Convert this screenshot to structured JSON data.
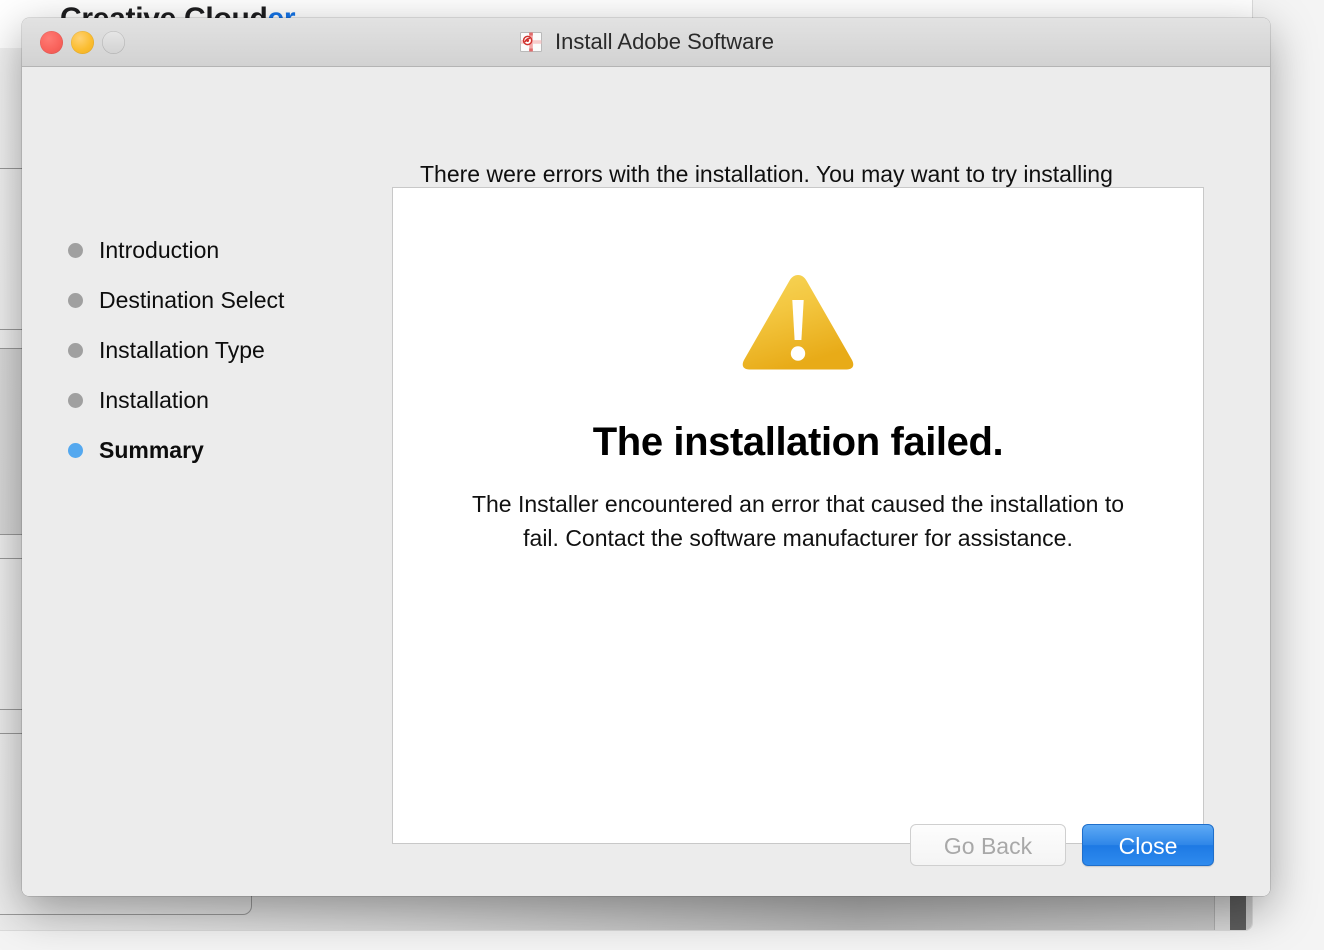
{
  "background_window": {
    "title_prefix": "Creative Cloud",
    "title_suffix": "er",
    "scrollbar": "vertical-scrollbar"
  },
  "installer": {
    "titlebar": {
      "title": "Install Adobe Software",
      "icon": "installer-package-icon",
      "close_button": "close",
      "minimize_button": "minimize",
      "zoom_button": "zoom"
    },
    "header_message": "There were errors with the installation. You may want to try installing",
    "sidebar": {
      "steps": [
        {
          "label": "Introduction",
          "state": "done"
        },
        {
          "label": "Destination Select",
          "state": "done"
        },
        {
          "label": "Installation Type",
          "state": "done"
        },
        {
          "label": "Installation",
          "state": "done"
        },
        {
          "label": "Summary",
          "state": "current"
        }
      ]
    },
    "panel": {
      "icon": "warning-triangle-icon",
      "title": "The installation failed.",
      "body": "The Installer encountered an error that caused the installation to fail. Contact the software manufacturer for assistance."
    },
    "buttons": {
      "go_back": "Go Back",
      "close": "Close"
    }
  },
  "colors": {
    "accent_blue": "#2e86e8",
    "current_step_dot": "#54a8ef",
    "step_dot": "#a0a0a0",
    "warning_yellow": "#f3c залог"
  }
}
